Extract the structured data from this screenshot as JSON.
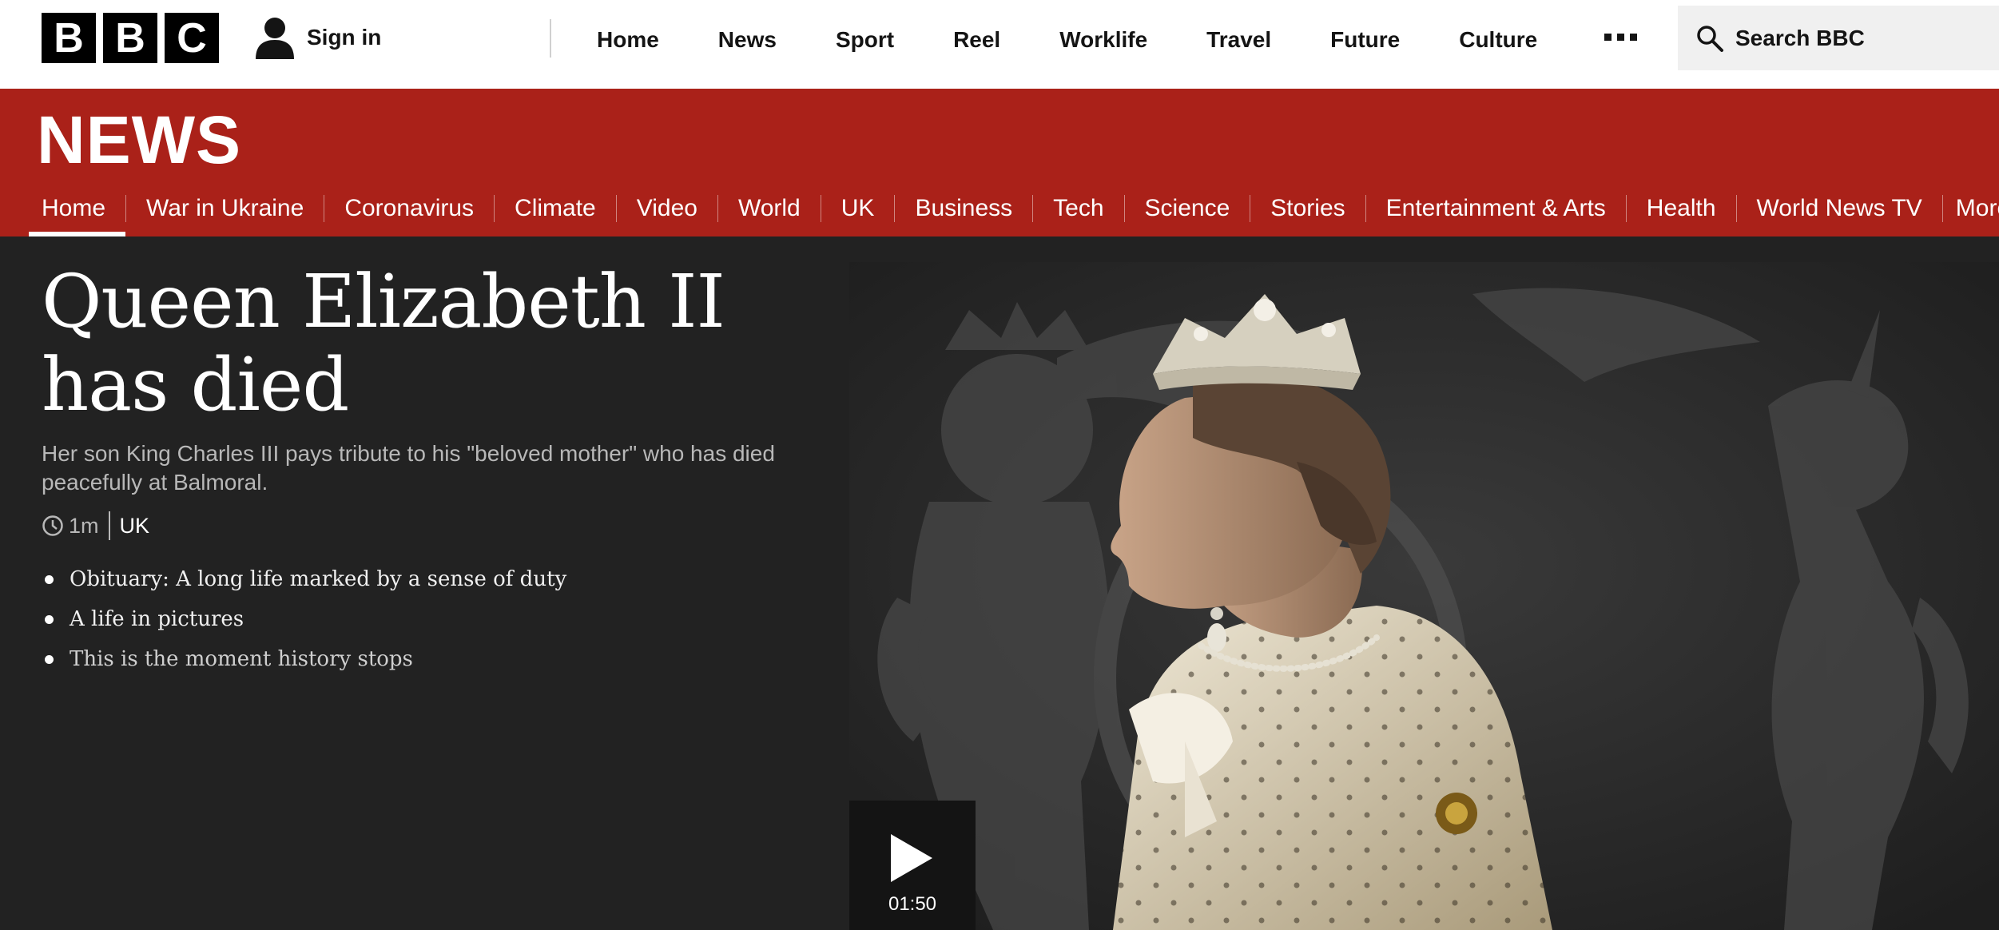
{
  "logo": {
    "letters": [
      "B",
      "B",
      "C"
    ]
  },
  "signin": {
    "label": "Sign in",
    "icon": "user-icon"
  },
  "topnav": {
    "items": [
      "Home",
      "News",
      "Sport",
      "Reel",
      "Worklife",
      "Travel",
      "Future",
      "Culture"
    ],
    "more_icon": "more-dots-icon"
  },
  "search": {
    "placeholder": "Search BBC",
    "icon": "search-icon"
  },
  "news": {
    "brand": "NEWS",
    "nav": [
      "Home",
      "War in Ukraine",
      "Coronavirus",
      "Climate",
      "Video",
      "World",
      "UK",
      "Business",
      "Tech",
      "Science",
      "Stories",
      "Entertainment & Arts",
      "Health",
      "World News TV"
    ],
    "active": "Home",
    "more_label": "More"
  },
  "article": {
    "headline": "Queen Elizabeth II has died",
    "summary": "Her son King Charles III pays tribute to his \"beloved mother\" who has died peacefully at Balmoral.",
    "time": "1m",
    "tag": "UK",
    "related": [
      "Obituary: A long life marked by a sense of duty",
      "A life in pictures",
      "This is the moment history stops"
    ]
  },
  "video": {
    "duration": "01:50",
    "icon": "play-icon"
  },
  "colors": {
    "news_red": "#aa2119",
    "content_bg": "#222222",
    "topbar_bg": "#ffffff"
  }
}
